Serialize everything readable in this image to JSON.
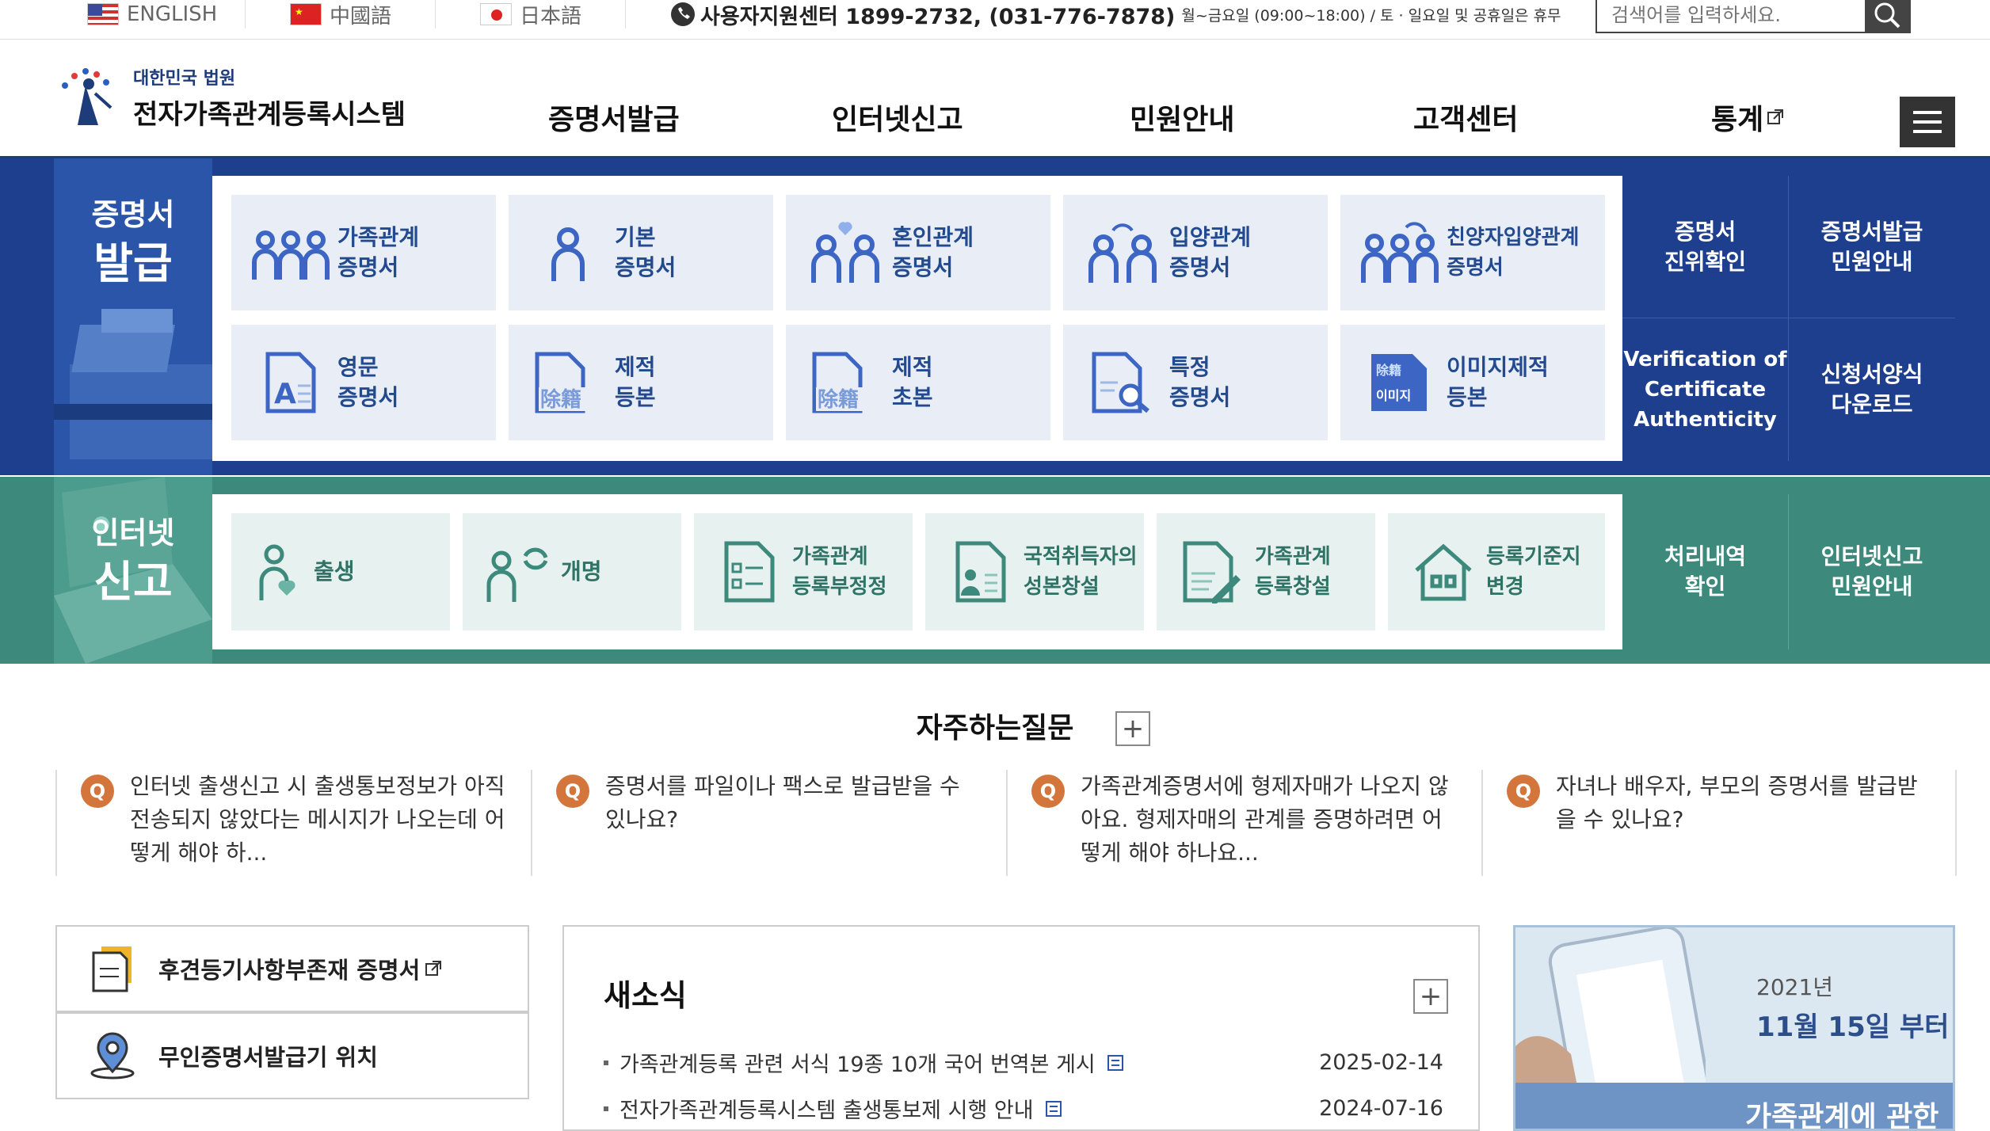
{
  "topbar": {
    "languages": [
      {
        "label": "ENGLISH"
      },
      {
        "label": "中國語"
      },
      {
        "label": "日本語"
      }
    ],
    "support_main": "사용자지원센터 1899-2732, (031-776-7878)",
    "support_hours": "월~금요일 (09:00~18:00) / 토 · 일요일 및 공휴일은 휴무",
    "search_placeholder": "검색어를 입력하세요."
  },
  "header": {
    "logo_sub": "대한민국 법원",
    "logo_main": "전자가족관계등록시스템",
    "nav": [
      "증명서발급",
      "인터넷신고",
      "민원안내",
      "고객센터",
      "통계"
    ]
  },
  "certificates": {
    "title_line1": "증명서",
    "title_line2": "발급",
    "tiles": [
      [
        "가족관계",
        "증명서"
      ],
      [
        "기본",
        "증명서"
      ],
      [
        "혼인관계",
        "증명서"
      ],
      [
        "입양관계",
        "증명서"
      ],
      [
        "친양자입양관계",
        "증명서"
      ],
      [
        "영문",
        "증명서"
      ],
      [
        "제적",
        "등본"
      ],
      [
        "제적",
        "초본"
      ],
      [
        "특정",
        "증명서"
      ],
      [
        "이미지제적",
        "등본"
      ]
    ],
    "side_links": [
      [
        "증명서",
        "진위확인"
      ],
      [
        "증명서발급",
        "민원안내"
      ],
      [
        "Verification of",
        "Certificate",
        "Authenticity"
      ],
      [
        "신청서양식",
        "다운로드"
      ]
    ],
    "icon_glyphs": {
      "removed_register": "除籍",
      "image_label": "이미지",
      "letter_a": "A"
    }
  },
  "reports": {
    "title_line1": "인터넷",
    "title_line2": "신고",
    "tiles": [
      [
        "출생"
      ],
      [
        "개명"
      ],
      [
        "가족관계",
        "등록부정정"
      ],
      [
        "국적취득자의",
        "성본창설"
      ],
      [
        "가족관계",
        "등록창설"
      ],
      [
        "등록기준지",
        "변경"
      ]
    ],
    "side_links": [
      [
        "처리내역",
        "확인"
      ],
      [
        "인터넷신고",
        "민원안내"
      ]
    ]
  },
  "faq": {
    "title": "자주하는질문",
    "badge": "Q",
    "items": [
      "인터넷 출생신고 시 출생통보정보가 아직 전송되지 않았다는 메시지가 나오는데 어떻게 해야 하...",
      "증명서를 파일이나 팩스로 발급받을 수 있나요?",
      "가족관계증명서에 형제자매가 나오지 않아요. 형제자매의 관계를 증명하려면 어떻게 해야 하나요...",
      "자녀나 배우자, 부모의 증명서를 발급받을 수 있나요?"
    ]
  },
  "quick_links": [
    "후견등기사항부존재 증명서",
    "무인증명서발급기 위치"
  ],
  "news": {
    "title": "새소식",
    "items": [
      {
        "title": "가족관계등록 관련 서식 19종 10개 국어 번역본 게시",
        "date": "2025-02-14"
      },
      {
        "title": "전자가족관계등록시스템 출생통보제 시행 안내",
        "date": "2024-07-16"
      }
    ]
  },
  "banner": {
    "year": "2021년",
    "date": "11월 15일 부터",
    "text": "가족관계에 관한"
  },
  "colors": {
    "blue_band": "#1e3f8e",
    "green_band": "#3d8a7c",
    "faq_badge": "#d4763b"
  }
}
